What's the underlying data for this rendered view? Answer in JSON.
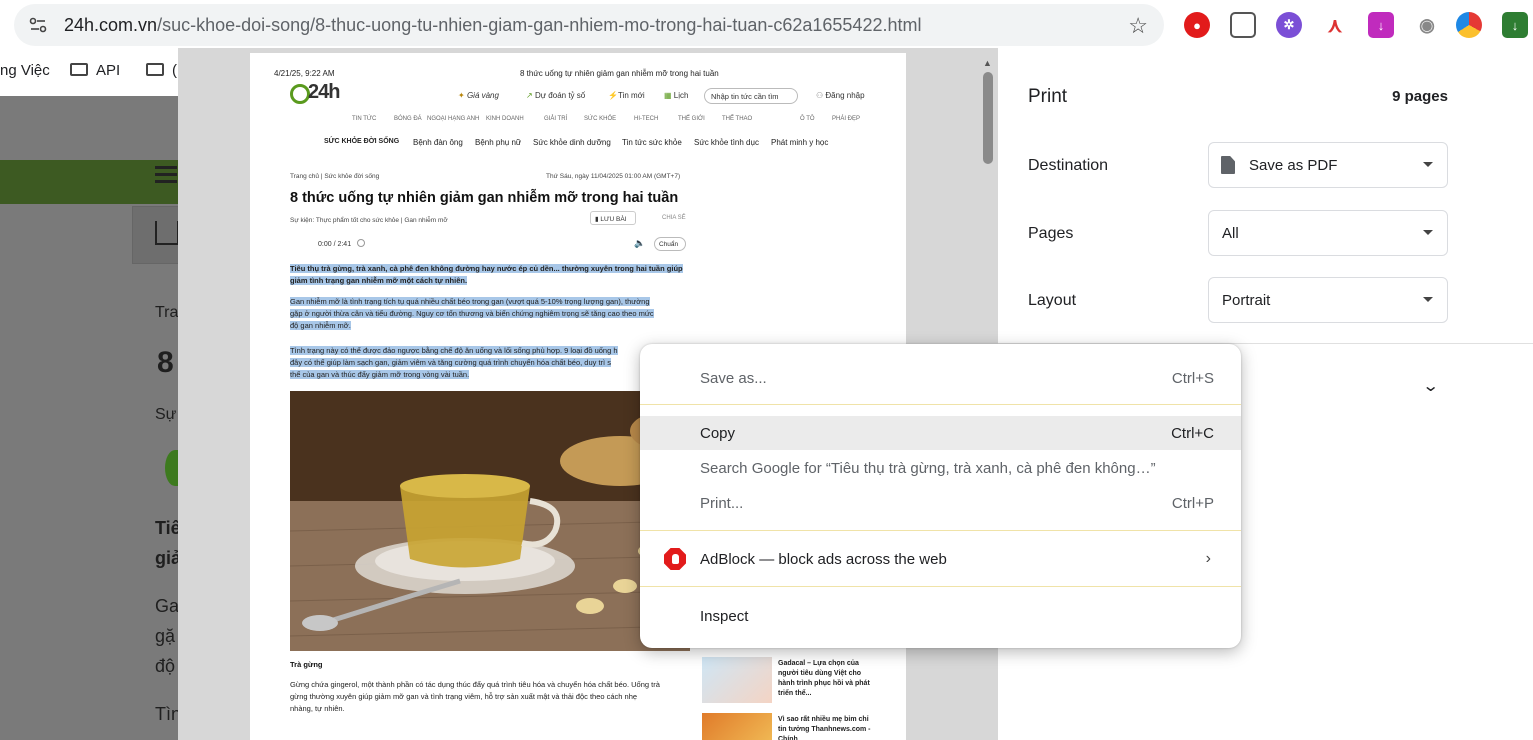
{
  "browser": {
    "url_host": "24h.com.vn",
    "url_path": "/suc-khoe-doi-song/8-thuc-uong-tu-nhien-giam-gan-nhiem-mo-trong-hai-tuan-c62a1655422.html",
    "bookmarks": [
      "ng Việc",
      "API",
      "("
    ]
  },
  "background_page": {
    "crumb": "Tra",
    "title_start": "8",
    "event_start": "Sự",
    "lead_1": "Tiê",
    "lead_2": "giả",
    "body_1": "Ga",
    "body_2": "gặ",
    "body_3": "độ",
    "body_4": "Tìn"
  },
  "preview": {
    "header_date": "4/21/25, 9:22 AM",
    "header_title": "8 thức uống tự nhiên giảm gan nhiễm mỡ trong hai tuần",
    "logo_text": "24h",
    "nav": {
      "gold": "Giá vàng",
      "lottery": "Dự đoán tỷ số",
      "news": "Tin mới",
      "calendar": "Lịch",
      "search_placeholder": "Nhập tin tức cần tìm",
      "login": "Đăng nhập"
    },
    "menu": [
      "TIN TỨC",
      "BÓNG ĐÁ",
      "NGOẠI HẠNG ANH",
      "KINH DOANH",
      "GIẢI TRÍ",
      "SỨC KHỎE",
      "HI-TECH",
      "THẾ GIỚI",
      "THỂ THAO",
      "Ô TÔ",
      "PHÁI ĐẸP"
    ],
    "submenu": [
      "SỨC KHỎE ĐỜI SỐNG",
      "Bệnh đàn ông",
      "Bệnh phụ nữ",
      "Sức khỏe dinh dưỡng",
      "Tin tức sức khỏe",
      "Sức khỏe tình dục",
      "Phát minh y học"
    ],
    "breadcrumb": "Trang chủ  |  Sức khỏe đời sống",
    "pubdate": "Thứ Sáu, ngày 11/04/2025 01:00 AM (GMT+7)",
    "title": "8 thức uống tự nhiên giảm gan nhiễm mỡ trong hai tuần",
    "event": "Sự kiện:  Thực phẩm tốt cho sức khỏe  |  Gan nhiễm mỡ",
    "save": "LƯU BÀI",
    "share": "CHIA SẺ",
    "audio_time": "0:00 / 2:41",
    "audio_quality": "Chuẩn",
    "lead_1": "Tiêu thụ trà gừng, trà xanh, cà phê đen không đường hay nước ép củ dền... thường xuyên trong hai tuần giúp",
    "lead_2": "giảm tình trạng gan nhiễm mỡ một cách tự nhiên.",
    "p1_1": "Gan nhiễm mỡ là tình trạng tích tụ quá nhiều chất béo trong gan (vượt quá 5-10% trọng lượng gan), thường",
    "p1_2": "gặp ở người thừa cân và tiểu đường. Nguy cơ tổn thương và biến chứng nghiêm trọng sẽ tăng cao theo mức",
    "p1_3": "độ gan nhiễm mỡ.",
    "p2_1": "Tình trạng này có thể được đảo ngược bằng chế độ ăn uống và lối sống phù hợp. 9 loại đồ uống h",
    "p2_2": "đây có thể giúp làm sạch gan, giảm viêm và tăng cường quá trình chuyển hóa chất béo, duy trì s",
    "p2_3": "thể của gan và thúc đẩy giảm mỡ trong vòng vài tuần.",
    "caption": "Trà gừng",
    "body_1": "Gừng chứa gingerol, một thành phần có tác dụng thúc đẩy quá trình tiêu hóa và chuyển hóa chất béo. Uống trà",
    "body_2": "gừng thường xuyên giúp giảm mỡ gan và tình trạng viêm, hỗ trợ sản xuất mật và thải độc theo cách nhẹ",
    "body_3": "nhàng, tự nhiên.",
    "side_1": "Gadacal – Lựa chọn của người tiêu dùng Việt cho hành trình phục hồi và phát triển thể...",
    "side_2": "Vì sao rất nhiều mẹ bỉm chỉ tin tưởng Thanhnews.com - Chính"
  },
  "print_panel": {
    "title": "Print",
    "pages_count": "9 pages",
    "destination_label": "Destination",
    "destination_value": "Save as PDF",
    "pages_label": "Pages",
    "pages_value": "All",
    "layout_label": "Layout",
    "layout_value": "Portrait"
  },
  "context_menu": {
    "save_as": "Save as...",
    "save_as_shortcut": "Ctrl+S",
    "copy": "Copy",
    "copy_shortcut": "Ctrl+C",
    "search": "Search Google for “Tiêu thụ trà gừng, trà xanh, cà phê đen không…”",
    "print": "Print...",
    "print_shortcut": "Ctrl+P",
    "adblock": "AdBlock — block ads across the web",
    "inspect": "Inspect"
  },
  "colors": {
    "accent_green": "#5a9a1e",
    "selection_blue": "#a8c7e8",
    "adblock_red": "#e21b1b"
  }
}
